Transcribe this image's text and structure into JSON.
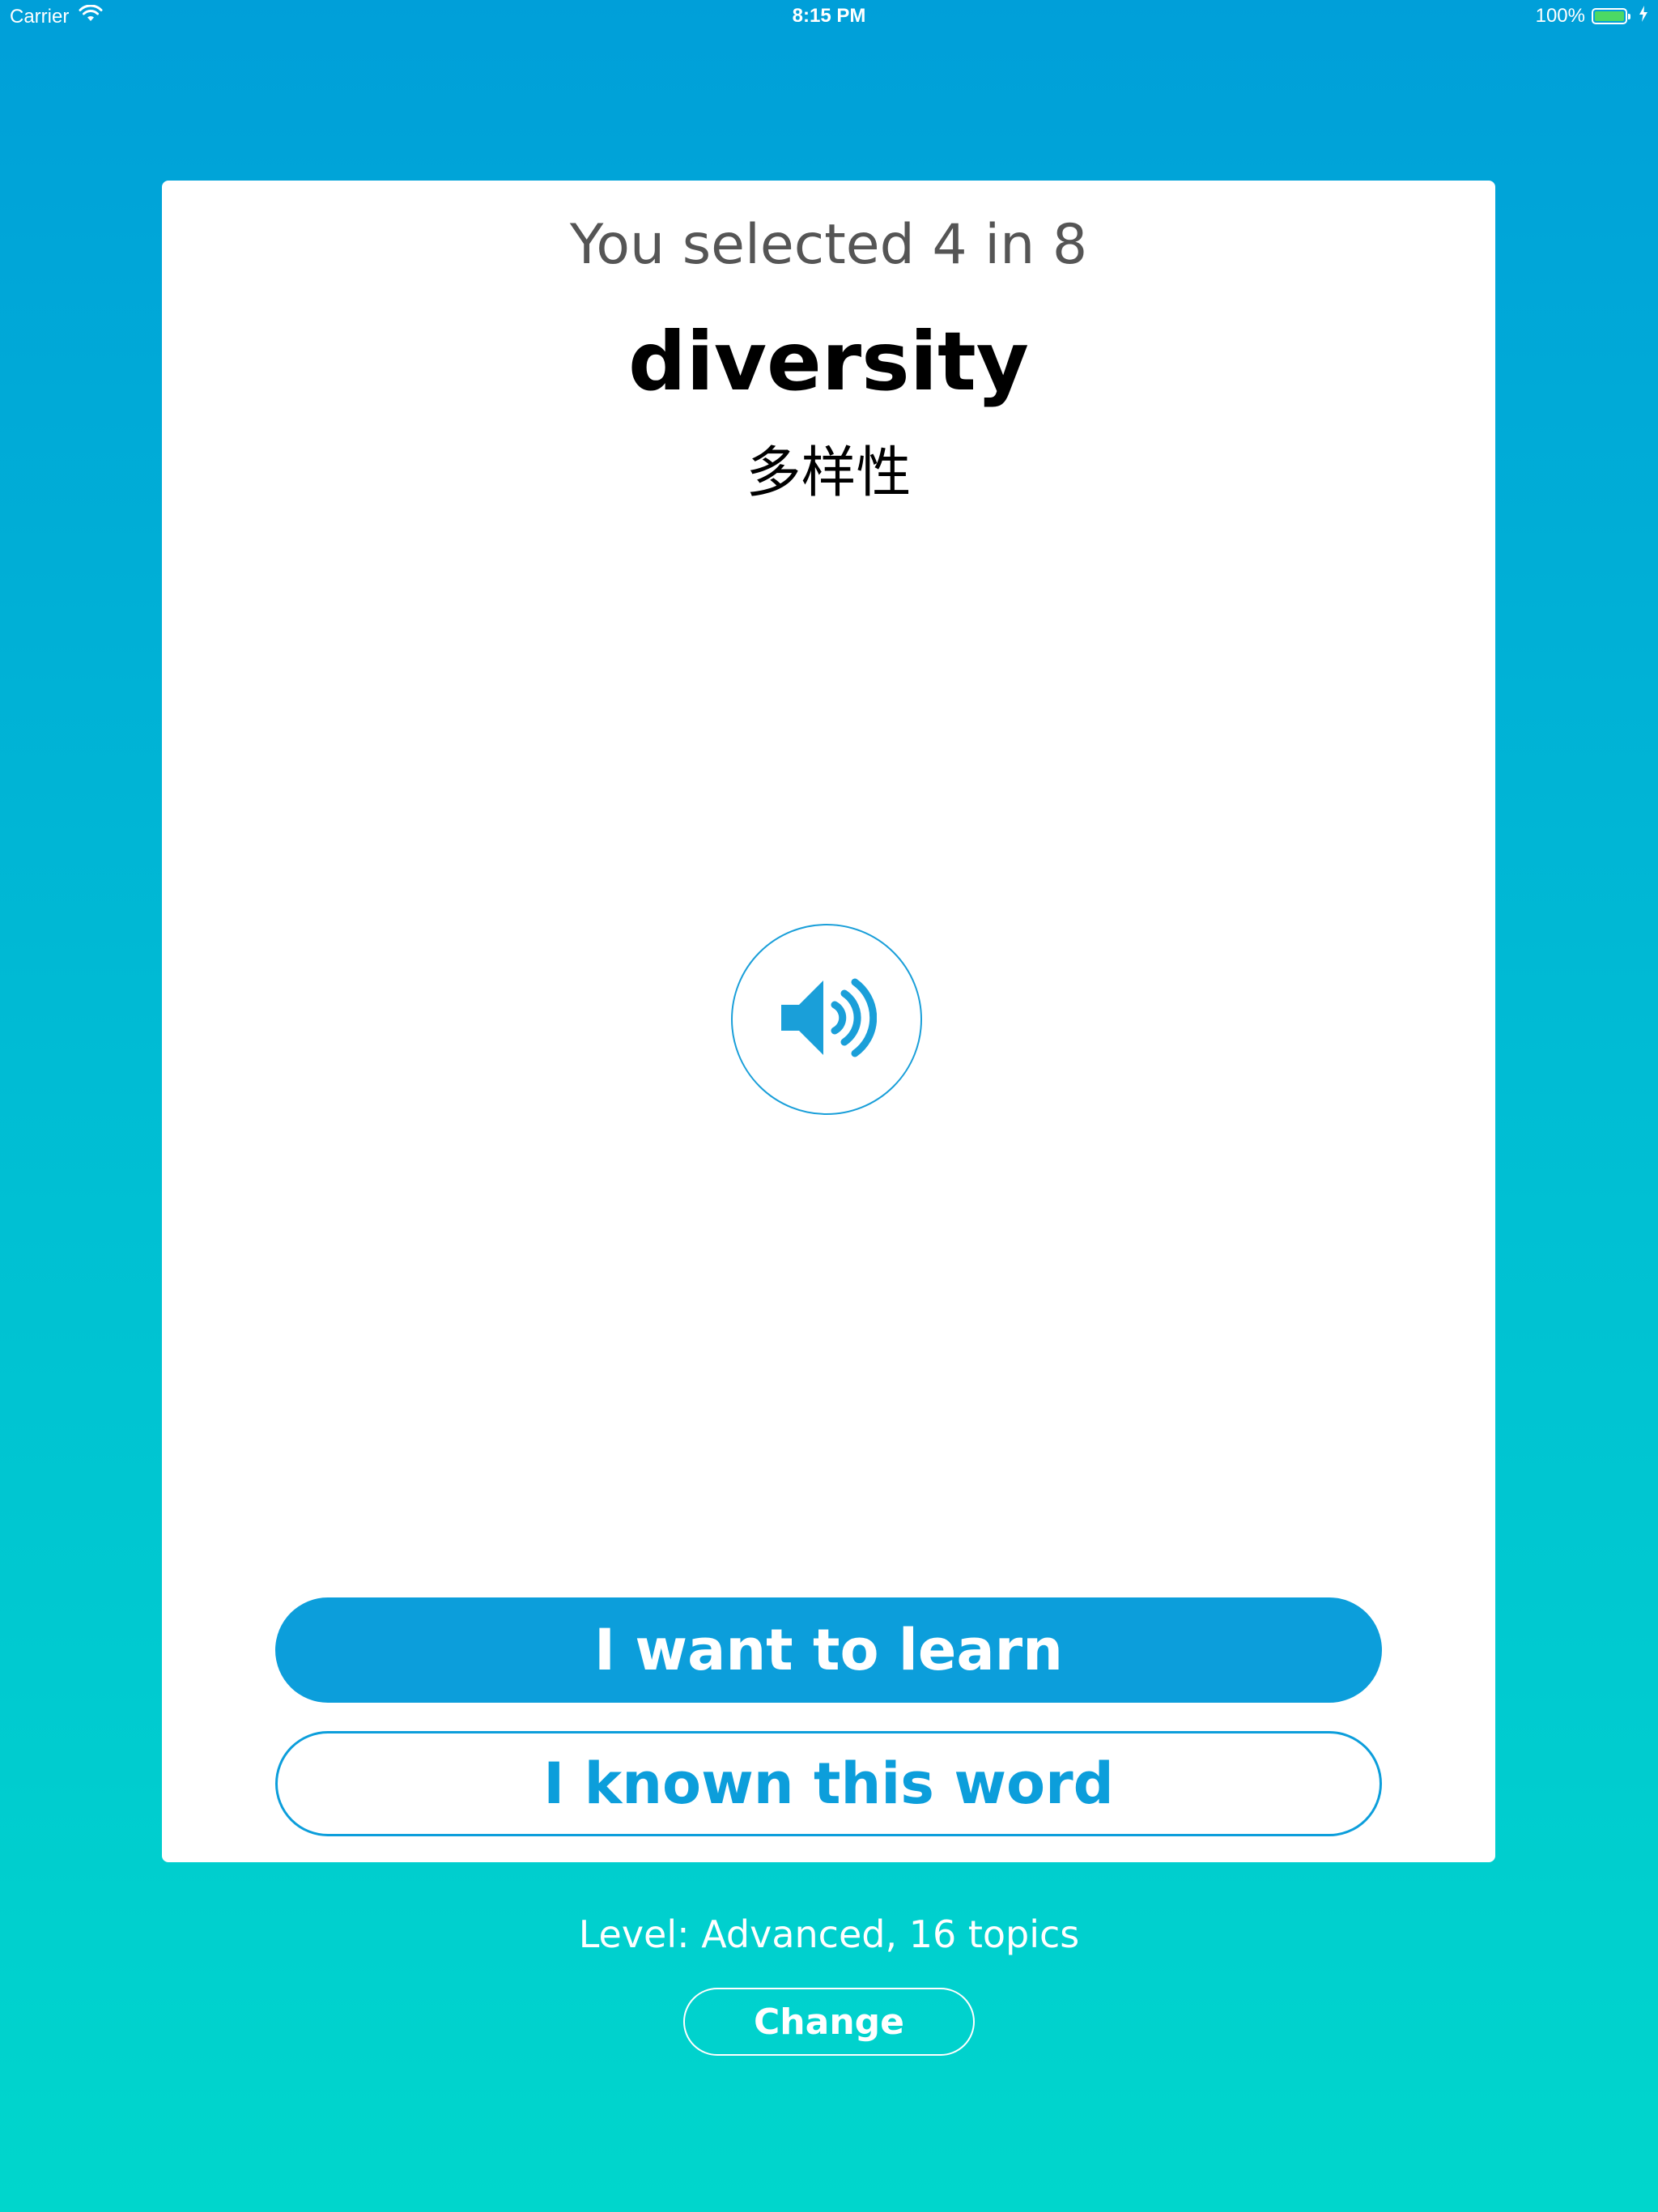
{
  "status_bar": {
    "carrier": "Carrier",
    "time": "8:15 PM",
    "battery_percent": "100%",
    "battery_level": 1.0,
    "battery_color": "#4cd964"
  },
  "card": {
    "selection_info": "You selected 4 in 8",
    "word": "diversity",
    "translation": "多样性",
    "audio_icon": "speaker-volume-icon",
    "primary_button_label": "I want to learn",
    "secondary_button_label": "I known this word"
  },
  "footer": {
    "level_info": "Level: Advanced, 16 topics",
    "change_button_label": "Change"
  },
  "colors": {
    "accent": "#0c9edb",
    "background_top": "#009fd9",
    "background_bottom": "#00d6cc"
  }
}
